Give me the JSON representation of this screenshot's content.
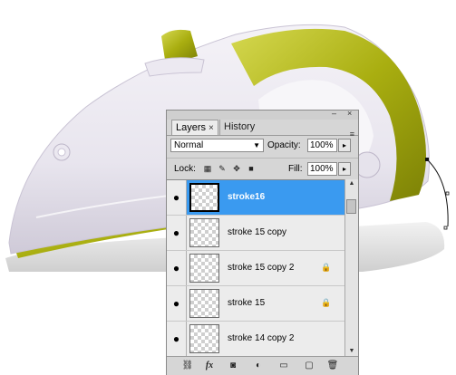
{
  "panel": {
    "tabs": [
      {
        "label": "Layers",
        "close": "×"
      },
      {
        "label": "History"
      }
    ],
    "window_controls": {
      "minimize": "–",
      "close": "×"
    },
    "menu_icon": "≡",
    "blend_mode": "Normal",
    "opacity_label": "Opacity:",
    "opacity_value": "100%",
    "lock_label": "Lock:",
    "fill_label": "Fill:",
    "fill_value": "100%",
    "layers": [
      {
        "name": "stroke16",
        "selected": true,
        "locked": false
      },
      {
        "name": "stroke 15 copy",
        "selected": false,
        "locked": false
      },
      {
        "name": "stroke 15 copy 2",
        "selected": false,
        "locked": true
      },
      {
        "name": "stroke 15",
        "selected": false,
        "locked": true
      },
      {
        "name": "stroke 14 copy 2",
        "selected": false,
        "locked": false
      }
    ],
    "bottom_icons": [
      "link-icon",
      "fx-icon",
      "mask-icon",
      "adjustment-icon",
      "folder-icon",
      "new-layer-icon",
      "trash-icon"
    ],
    "fx_label": "fx"
  },
  "colors": {
    "selection": "#3a9af0",
    "iron_accent": "#b3b81a",
    "panel_bg": "#d6d6d6"
  }
}
